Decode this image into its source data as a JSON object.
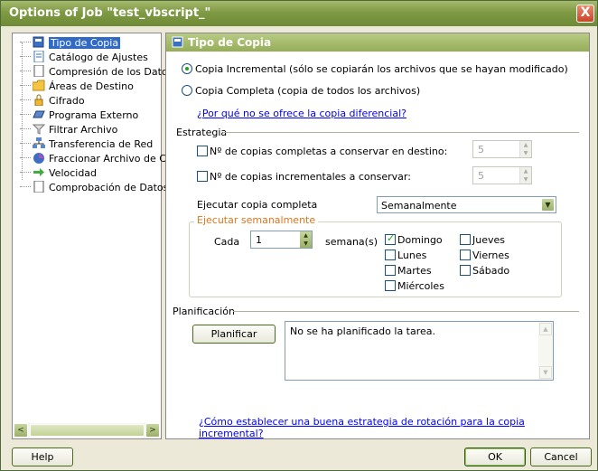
{
  "window": {
    "title": "Options of Job \"test_vbscript_\"",
    "close_label": "X"
  },
  "tree": {
    "items": [
      {
        "label": "Tipo de Copia",
        "icon": "document-icon",
        "selected": true
      },
      {
        "label": "Catálogo de Ajustes",
        "icon": "catalog-icon"
      },
      {
        "label": "Compresión de los Datos",
        "icon": "page-icon"
      },
      {
        "label": "Áreas de Destino",
        "icon": "folder-icon"
      },
      {
        "label": "Cifrado",
        "icon": "lock-icon"
      },
      {
        "label": "Programa Externo",
        "icon": "program-icon"
      },
      {
        "label": "Filtrar Archivo",
        "icon": "filter-icon"
      },
      {
        "label": "Transferencia de Red",
        "icon": "network-icon"
      },
      {
        "label": "Fraccionar Archivo de Copi",
        "icon": "split-icon"
      },
      {
        "label": "Velocidad",
        "icon": "arrow-icon"
      },
      {
        "label": "Comprobación de Datos",
        "icon": "page-icon"
      }
    ],
    "scroll_left": "<",
    "scroll_right": ">"
  },
  "panel": {
    "header": "Tipo de Copia",
    "radio_incremental": "Copia Incremental (sólo se copiarán los archivos que se hayan modificado)",
    "radio_full": "Copia Completa (copia de todos los archivos)",
    "diff_link": "¿Por qué no se ofrece la copia diferencial?",
    "strategy_title": "Estrategia",
    "chk_full_copies": "Nº de copias completas a conservar en destino:",
    "full_copies_value": "5",
    "chk_incr_copies": "Nº de copias incrementales a conservar:",
    "incr_copies_value": "5",
    "exec_full_label": "Ejecutar copia completa",
    "exec_full_value": "Semanalmente",
    "weekly_title": "Ejecutar semanalmente",
    "each_label": "Cada",
    "each_value": "1",
    "weeks_label": "semana(s)",
    "days": [
      {
        "label": "Domingo",
        "checked": true
      },
      {
        "label": "Lunes",
        "checked": false
      },
      {
        "label": "Martes",
        "checked": false
      },
      {
        "label": "Miércoles",
        "checked": false
      },
      {
        "label": "Jueves",
        "checked": false
      },
      {
        "label": "Viernes",
        "checked": false
      },
      {
        "label": "Sábado",
        "checked": false
      }
    ],
    "planning_title": "Planificación",
    "plan_button": "Planificar",
    "plan_status": "No se ha planificado la tarea.",
    "rotation_link": "¿Cómo establecer una buena estrategia de rotación para la copia incremental?"
  },
  "footer": {
    "help": "Help",
    "ok": "OK",
    "cancel": "Cancel"
  },
  "colors": {
    "title_bar": "#7f9a44",
    "selection": "#316ac5",
    "accent_orange": "#e0751a",
    "link": "#0000ff"
  }
}
